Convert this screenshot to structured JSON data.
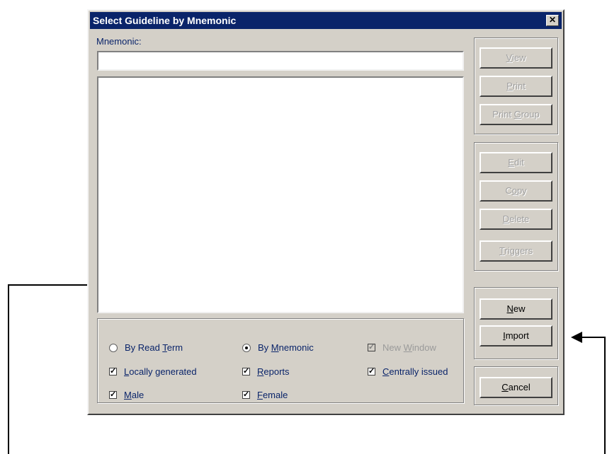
{
  "window": {
    "title": "Select Guideline by Mnemonic",
    "close_glyph": "✕"
  },
  "mnemonic": {
    "label": "Mnemonic:",
    "value": ""
  },
  "buttons": {
    "view": {
      "pre": "",
      "key": "V",
      "post": "iew"
    },
    "print": {
      "pre": "",
      "key": "P",
      "post": "rint"
    },
    "print_group": {
      "pre": "Print ",
      "key": "G",
      "post": "roup"
    },
    "edit": {
      "pre": "",
      "key": "E",
      "post": "dit"
    },
    "copy": {
      "pre": "C",
      "key": "o",
      "post": "py"
    },
    "delete": {
      "pre": "",
      "key": "D",
      "post": "elete"
    },
    "triggers": {
      "pre": "",
      "key": "T",
      "post": "riggers"
    },
    "new": {
      "pre": "",
      "key": "N",
      "post": "ew"
    },
    "import": {
      "pre": "",
      "key": "I",
      "post": "mport"
    },
    "cancel": {
      "pre": "",
      "key": "C",
      "post": "ancel"
    }
  },
  "options": {
    "by_read_term": {
      "pre": "By Read ",
      "key": "T",
      "post": "erm",
      "selected": false
    },
    "by_mnemonic": {
      "pre": "By ",
      "key": "M",
      "post": "nemonic",
      "selected": true
    },
    "new_window": {
      "pre": "New ",
      "key": "W",
      "post": "indow",
      "checked": true
    },
    "locally_generated": {
      "pre": "",
      "key": "L",
      "post": "ocally generated",
      "checked": true
    },
    "reports": {
      "pre": "",
      "key": "R",
      "post": "eports",
      "checked": true
    },
    "centrally_issued": {
      "pre": "",
      "key": "C",
      "post": "entrally issued",
      "checked": true
    },
    "male": {
      "pre": "",
      "key": "M",
      "post": "ale",
      "checked": true
    },
    "female": {
      "pre": "",
      "key": "F",
      "post": "emale",
      "checked": true
    }
  },
  "icons": {
    "check": "checkmark-icon",
    "close": "close-icon"
  },
  "colors": {
    "titlebar": "#0a246a",
    "label_text": "#0a246a",
    "face": "#d4d0c8"
  }
}
